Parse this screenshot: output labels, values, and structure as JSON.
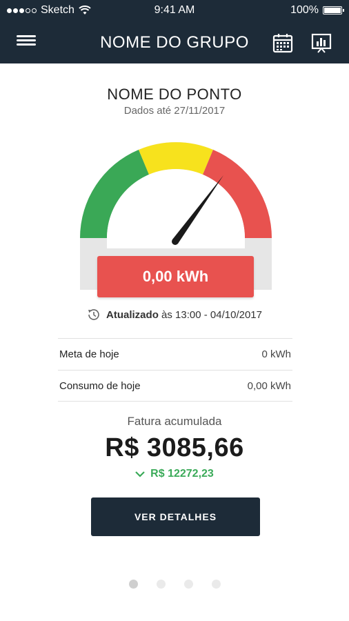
{
  "status_bar": {
    "carrier": "Sketch",
    "time": "9:41 AM",
    "battery": "100%"
  },
  "header": {
    "title": "NOME DO GRUPO",
    "icons": {
      "menu": "menu-icon",
      "calendar": "calendar-icon",
      "report": "bar-chart-presentation-icon"
    }
  },
  "point": {
    "name": "NOME DO PONTO",
    "data_until": "Dados até 27/11/2017"
  },
  "gauge": {
    "segments": [
      "green",
      "yellow",
      "red"
    ],
    "colors": {
      "green": "#3aa856",
      "yellow": "#f7e21d",
      "red": "#e8524f",
      "track": "#e6e6e6"
    },
    "reading": "0,00 kWh"
  },
  "updated": {
    "label": "Atualizado",
    "time": "às 13:00 - 04/10/2017"
  },
  "stats": [
    {
      "label": "Meta de hoje",
      "value": "0 kWh"
    },
    {
      "label": "Consumo de hoje",
      "value": "0,00 kWh"
    }
  ],
  "billing": {
    "label": "Fatura acumulada",
    "value": "R$ 3085,66",
    "difference": "R$ 12272,23"
  },
  "actions": {
    "details": "VER DETALHES"
  },
  "pager": {
    "count": 4,
    "active": 1
  },
  "colors": {
    "header_bg": "#1d2b38",
    "positive": "#3aaa58"
  }
}
